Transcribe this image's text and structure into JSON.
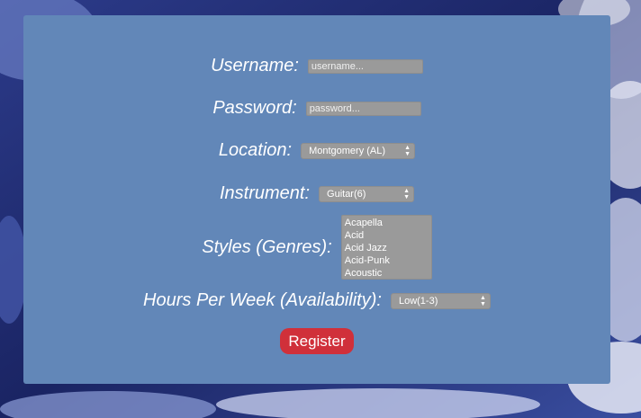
{
  "form": {
    "username": {
      "label": "Username:",
      "value": "",
      "placeholder": "username..."
    },
    "password": {
      "label": "Password:",
      "value": "",
      "placeholder": "password..."
    },
    "location": {
      "label": "Location:",
      "selected": "Montgomery (AL)"
    },
    "instrument": {
      "label": "Instrument:",
      "selected": "Guitar(6)"
    },
    "styles": {
      "label": "Styles (Genres):",
      "options": [
        "Acapella",
        "Acid",
        "Acid Jazz",
        "Acid-Punk",
        "Acoustic"
      ]
    },
    "hours": {
      "label": "Hours Per Week (Availability):",
      "selected": "Low(1-3)"
    },
    "register_label": "Register"
  },
  "colors": {
    "panel": "#6287b8",
    "field": "#9a9a9a",
    "button": "#d0303a",
    "text": "#ffffff"
  },
  "icons": {
    "select_arrow": "chevron-up-down-icon"
  }
}
